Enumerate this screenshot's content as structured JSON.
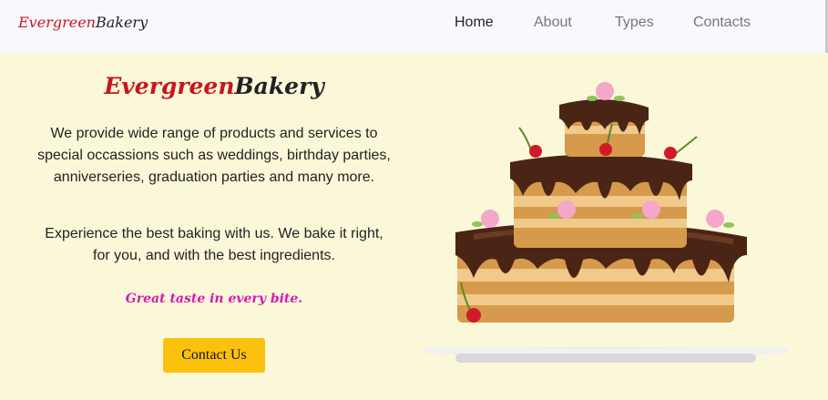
{
  "navbar": {
    "brand_part1": "Evergreen",
    "brand_part2": "Bakery",
    "links": [
      "Home",
      "About",
      "Types",
      "Contacts"
    ],
    "active": "Home"
  },
  "hero": {
    "title_part1": "Evergreen",
    "title_part2": "Bakery",
    "paragraph1": "We provide wide range of products and services to special occassions such as weddings, birthday parties, anniverseries, graduation parties and many more.",
    "paragraph2": "Experience the best baking with us. We bake it right, for you, and with the best ingredients.",
    "tagline": "Great taste in every bite.",
    "contact_button": "Contact Us"
  },
  "colors": {
    "background": "#fbf8d9",
    "navbar": "#f8f9fc",
    "brand_red": "#c8161d",
    "tagline_pink": "#d51ab0",
    "button_yellow": "#fcc10c"
  },
  "image": {
    "name": "chocolate-cake-icon"
  }
}
